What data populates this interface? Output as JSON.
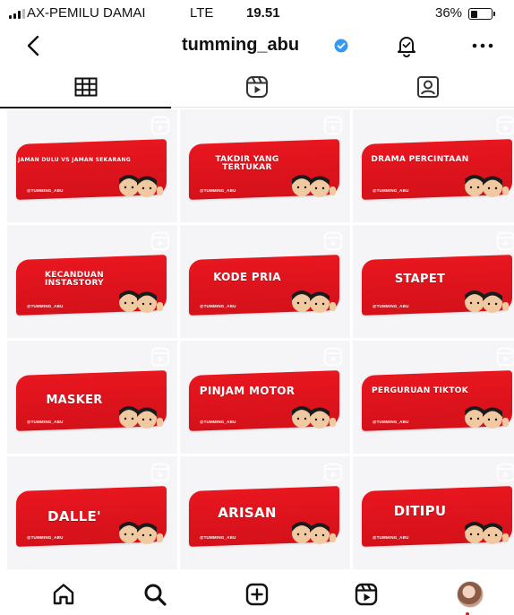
{
  "status_bar": {
    "carrier": "AX-PEMILU DAMAI",
    "network": "LTE",
    "time": "19.51",
    "battery": "36%",
    "battery_level": 0.36
  },
  "header": {
    "username": "tumming_abu",
    "verified": true,
    "icons": {
      "back": "chevron-left-icon",
      "notify": "bell-icon",
      "more": "more-horizontal-icon",
      "verified": "verified-badge-icon"
    }
  },
  "tabs": [
    {
      "icon": "grid-icon",
      "active": true
    },
    {
      "icon": "reels-icon",
      "active": false
    },
    {
      "icon": "tagged-icon",
      "active": false
    }
  ],
  "posts": [
    {
      "title": "JAMAN DULU VS JAMAN SEKARANG",
      "handle": "@TUMMING_ABU"
    },
    {
      "title": "TAKDIR YANG TERTUKAR",
      "handle": "@TUMMING_ABU"
    },
    {
      "title": "DRAMA PERCINTAAN",
      "handle": "@TUMMING_ABU"
    },
    {
      "title": "KECANDUAN INSTASTORY",
      "handle": "@TUMMING_ABU"
    },
    {
      "title": "KODE PRIA",
      "handle": "@TUMMING_ABU"
    },
    {
      "title": "STAPET",
      "handle": "@TUMMING_ABU"
    },
    {
      "title": "MASKER",
      "handle": "@TUMMING_ABU"
    },
    {
      "title": "PINJAM MOTOR",
      "handle": "@TUMMING_ABU"
    },
    {
      "title": "PERGURUAN TIKTOK",
      "handle": "@TUMMING_ABU"
    },
    {
      "title": "DALLE'",
      "handle": "@TUMMING_ABU"
    },
    {
      "title": "ARISAN",
      "handle": "@TUMMING_ABU"
    },
    {
      "title": "DITIPU",
      "handle": "@TUMMING_ABU"
    }
  ],
  "bottom_nav": [
    {
      "icon": "home-icon"
    },
    {
      "icon": "search-icon"
    },
    {
      "icon": "add-post-icon"
    },
    {
      "icon": "reels-icon"
    },
    {
      "icon": "profile-avatar"
    }
  ],
  "colors": {
    "accent_red": "#e8161f",
    "verified_blue": "#3897f0",
    "notification_dot": "#e0162b"
  }
}
